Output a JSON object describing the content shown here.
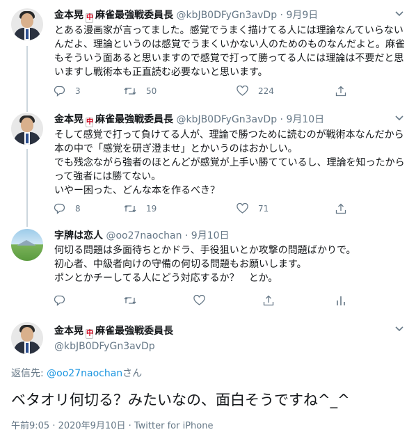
{
  "tweets": [
    {
      "name": "金本晃",
      "badge": "中",
      "name_suffix": "麻雀最強戦委員長",
      "handle": "@kbJB0DFyGn3avDp",
      "date": "· 9月9日",
      "text": "とある漫画家が言ってました。感覚でうまく描けてる人には理論なんていらないんだよ、理論というのは感覚でうまくいかない人のためのものなんだよと。麻雀もそういう面あると思いますので感覚で打って勝ってる人には理論は不要だと思いますし戦術本も正直読む必要ないと思います。",
      "replies": "3",
      "retweets": "50",
      "likes": "224"
    },
    {
      "name": "金本晃",
      "badge": "中",
      "name_suffix": "麻雀最強戦委員長",
      "handle": "@kbJB0DFyGn3avDp",
      "date": "· 9月10日",
      "text": "そして感覚で打って負けてる人が、理論で勝つために読むのが戦術本なんだから本の中で「感覚を研ぎ澄ませ」とかいうのはおかしい。\nでも残念ながら強者のほとんどが感覚が上手い勝てているし、理論を知ったからって強者には勝てない。\nいやー困った、どんな本を作るべき？",
      "replies": "8",
      "retweets": "19",
      "likes": "71"
    },
    {
      "name": "字牌は恋人",
      "handle": "@oo27naochan",
      "date": "· 9月10日",
      "text": "何切る問題は多面待ちとかドラ、手役狙いとか攻撃の問題ばかりで。\n初心者、中級者向けの守備の何切る問題もお願いします。\nポンとかチーしてる人にどう対応するか？　とか。",
      "replies": "",
      "retweets": "",
      "likes": ""
    }
  ],
  "main": {
    "name": "金本晃",
    "badge": "中",
    "name_suffix": "麻雀最強戦委員長",
    "handle": "@kbJB0DFyGn3avDp",
    "reply_prefix": "返信先: ",
    "reply_handle": "@oo27naochan",
    "reply_suffix": "さん",
    "text": "ベタオリ何切る？みたいなの、面白そうですね^_^",
    "meta": "午前9:05 · 2020年9月10日 · Twitter for iPhone"
  },
  "icons": [
    "reply-icon",
    "retweet-icon",
    "like-icon",
    "share-icon",
    "analytics-icon",
    "caret-down-icon"
  ],
  "colors": {
    "text": "#14171a",
    "secondary": "#657786",
    "link": "#1b95e0",
    "thread": "#ccd6dd",
    "badge": "#d0021b"
  }
}
